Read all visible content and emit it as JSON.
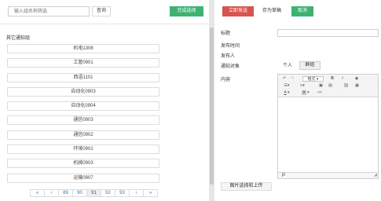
{
  "search": {
    "placeholder": "输入组名称筛选",
    "button": "查询"
  },
  "done_button": "完成选择",
  "group_section": {
    "title": "其它通知组",
    "items": [
      "机电1306",
      "工管0901",
      "西语1101",
      "自动化0903",
      "自动化0904",
      "通信0903",
      "通信0902",
      "环境0901",
      "机械0903",
      "运输0907"
    ]
  },
  "pagination": [
    "«",
    "‹",
    "89",
    "90",
    "91",
    "92",
    "93",
    "›",
    "»"
  ],
  "pagination_active": "91",
  "actions": {
    "publish": "立即发送",
    "draft": "存为草稿",
    "cancel": "取消"
  },
  "form": {
    "title_label": "标题",
    "time_label": "发布时间",
    "publisher_label": "发布人",
    "target_label": "通知对象",
    "target_options": [
      "个人",
      "群组"
    ],
    "target_selected": "群组",
    "content_label": "内容"
  },
  "editor": {
    "format_label": "格式",
    "status": "P",
    "toolbar_icons": [
      "undo-icon",
      "redo-icon",
      "format-dropdown",
      "bold-icon",
      "italic-icon",
      "eye-icon",
      "unordered-list-icon",
      "ordered-list-icon",
      "image-icon",
      "table-icon",
      "link-icon",
      "media-icon",
      "text-color-icon",
      "background-color-icon",
      "code-icon"
    ]
  },
  "upload_button": "图片选择和上传",
  "colors": {
    "green": "#3cb371",
    "red": "#d9534f",
    "link": "#337ab7"
  }
}
